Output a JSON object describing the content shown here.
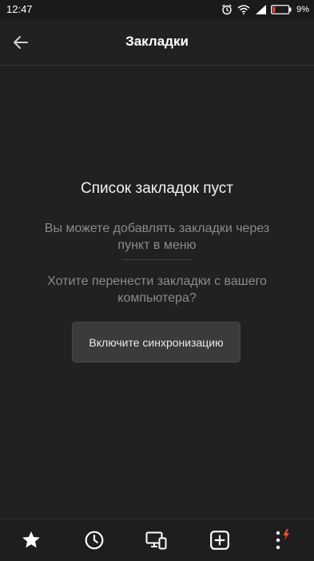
{
  "status_bar": {
    "time": "12:47",
    "battery_percent": "9%",
    "icons": [
      "alarm-icon",
      "wifi-icon",
      "signal-icon",
      "battery-icon"
    ]
  },
  "app_bar": {
    "title": "Закладки",
    "back_icon": "arrow-left-icon"
  },
  "empty_state": {
    "title": "Список закладок пуст",
    "hint_add": "Вы можете добавлять закладки через пункт в меню",
    "hint_transfer": "Хотите перенести закладки с вашего компьютера?",
    "sync_button_label": "Включите синхронизацию"
  },
  "bottom_nav": {
    "items": [
      "star-icon",
      "clock-icon",
      "devices-icon",
      "add-tab-icon",
      "more-menu-icon"
    ]
  },
  "colors": {
    "background": "#212121",
    "text_primary": "#f2f2f2",
    "text_secondary": "#8a8a8a",
    "button_bg": "#3b3b3b",
    "badge": "#ff4d2e"
  }
}
